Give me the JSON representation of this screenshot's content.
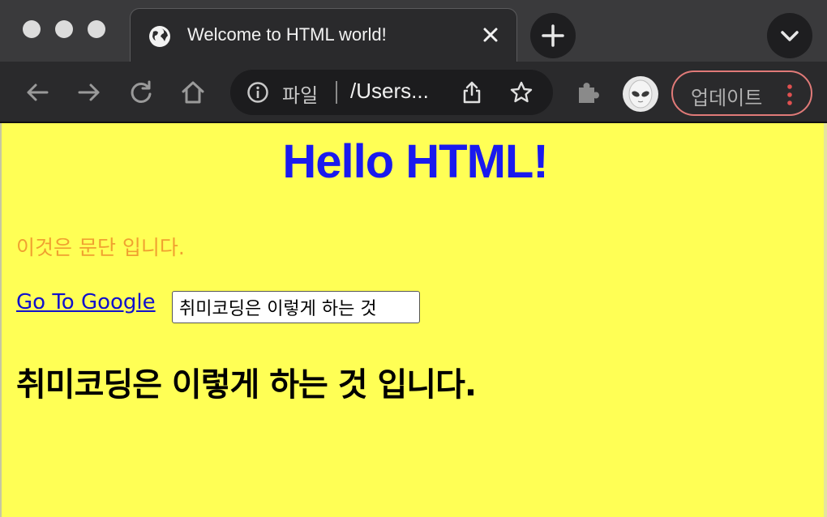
{
  "tab": {
    "title": "Welcome to HTML world!",
    "favicon": "globe-icon",
    "close": "close-icon"
  },
  "toolbar": {
    "omnibox": {
      "scheme_label": "파일",
      "url": "/Users...",
      "info_icon": "info-icon",
      "share_icon": "share-icon",
      "bookmark_icon": "star-icon"
    },
    "update_label": "업데이트"
  },
  "page": {
    "heading": "Hello HTML!",
    "paragraph": "이것은 문단 입니다.",
    "link_text": "Go To Google",
    "input_value": "취미코딩은 이렇게 하는 것",
    "subheading": "취미코딩은 이렇게 하는 것 입니다."
  },
  "colors": {
    "page_background": "#ffff55",
    "heading": "#1a1aee",
    "paragraph": "#f0a030",
    "link": "#1010cc",
    "update_border": "#e07a78"
  }
}
